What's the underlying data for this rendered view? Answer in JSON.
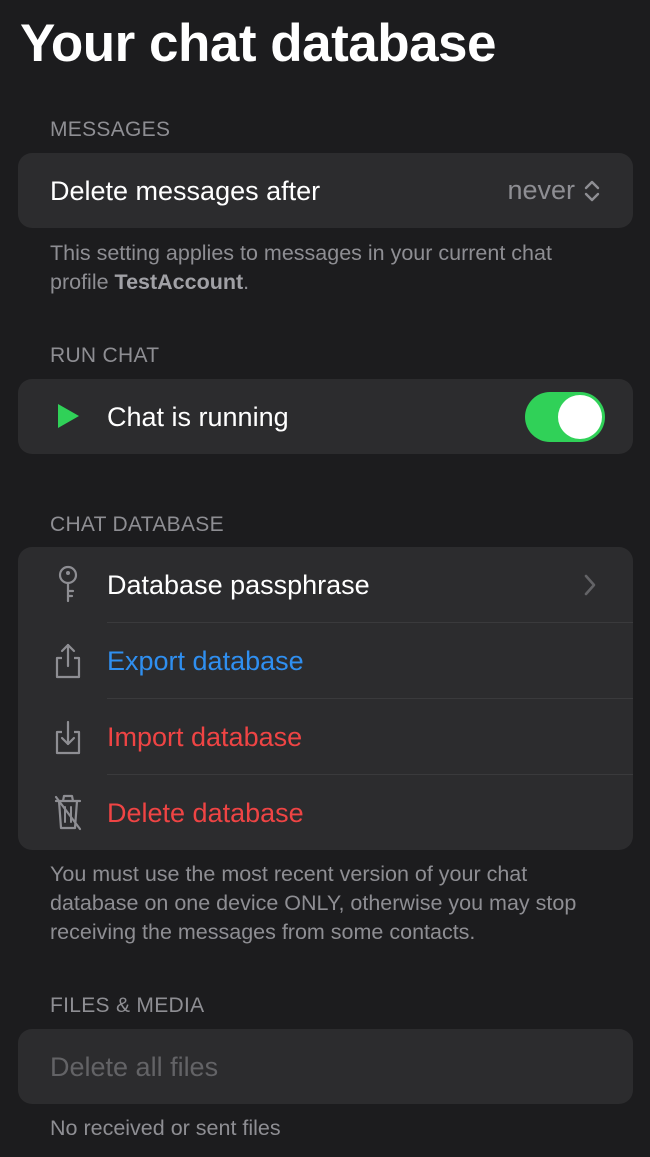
{
  "page": {
    "title": "Your chat database"
  },
  "messages": {
    "header": "MESSAGES",
    "delete_after_label": "Delete messages after",
    "delete_after_value": "never",
    "footer_prefix": "This setting applies to messages in your current chat profile ",
    "footer_profile": "TestAccount",
    "footer_suffix": "."
  },
  "run_chat": {
    "header": "RUN CHAT",
    "label": "Chat is running",
    "toggle_on": true
  },
  "chat_database": {
    "header": "CHAT DATABASE",
    "items": [
      {
        "label": "Database passphrase",
        "icon": "key-icon"
      },
      {
        "label": "Export database",
        "icon": "share-icon"
      },
      {
        "label": "Import database",
        "icon": "import-icon"
      },
      {
        "label": "Delete database",
        "icon": "trash-slash-icon"
      }
    ],
    "footer": "You must use the most recent version of your chat database on one device ONLY, otherwise you may stop receiving the messages from some contacts."
  },
  "files_media": {
    "header": "FILES & MEDIA",
    "delete_all_label": "Delete all files",
    "footer": "No received or sent files"
  },
  "colors": {
    "background": "#1c1c1e",
    "card": "#2c2c2e",
    "accent_blue": "#2f8ff0",
    "destructive_red": "#ef4444",
    "toggle_green": "#30d158"
  }
}
